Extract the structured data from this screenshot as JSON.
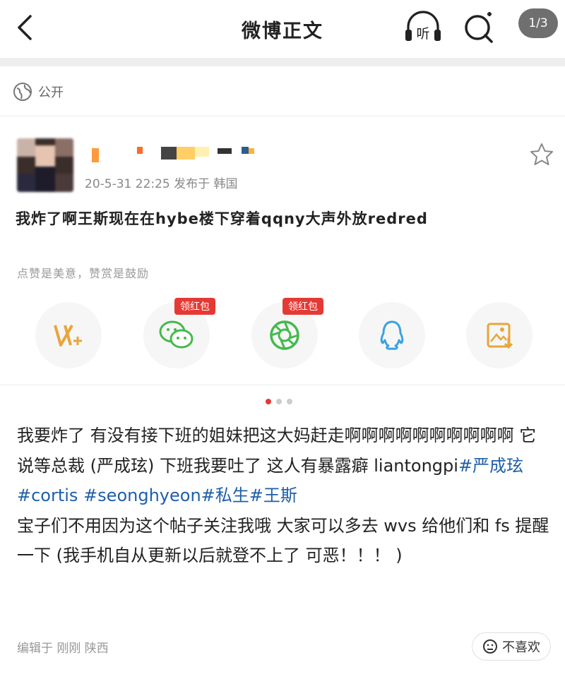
{
  "header": {
    "title": "微博正文",
    "listen_label": "听",
    "page_indicator": "1/3",
    "back_icon": "chevron-left-icon",
    "search_icon": "search-icon"
  },
  "visibility": {
    "label": "公开",
    "icon": "globe-icon"
  },
  "post": {
    "meta": "20-5-31 22:25  发布于 韩国",
    "headline": "我炸了啊王斯现在在hybe楼下穿着qqny大声外放redred",
    "reward_hint": "点赞是美意，赞赏是鼓励",
    "share": {
      "badge1": "领红包",
      "badge2": "领红包"
    },
    "body": {
      "p1": "我要炸了 有没有接下班的姐妹把这大妈赶走啊啊啊啊啊啊啊啊啊啊 它说等总裁 (严成玹) 下班我要吐了  这人有暴露癖 liantongpi",
      "tag1": "#严成玹",
      "tag2": " #cortis",
      "tag3": " #seonghyeon",
      "tag4": "#私生",
      "tag5": "#王斯",
      "p2": "宝子们不用因为这个帖子关注我哦  大家可以多去 wvs 给他们和 fs 提醒一下 (我手机自从更新以后就登不上了 可恶！！！ )"
    },
    "edited": "编辑于 刚刚 陕西",
    "dislike_label": "不喜欢"
  },
  "colors": {
    "accent_red": "#e53935",
    "tag_blue": "#1f5fa8"
  }
}
